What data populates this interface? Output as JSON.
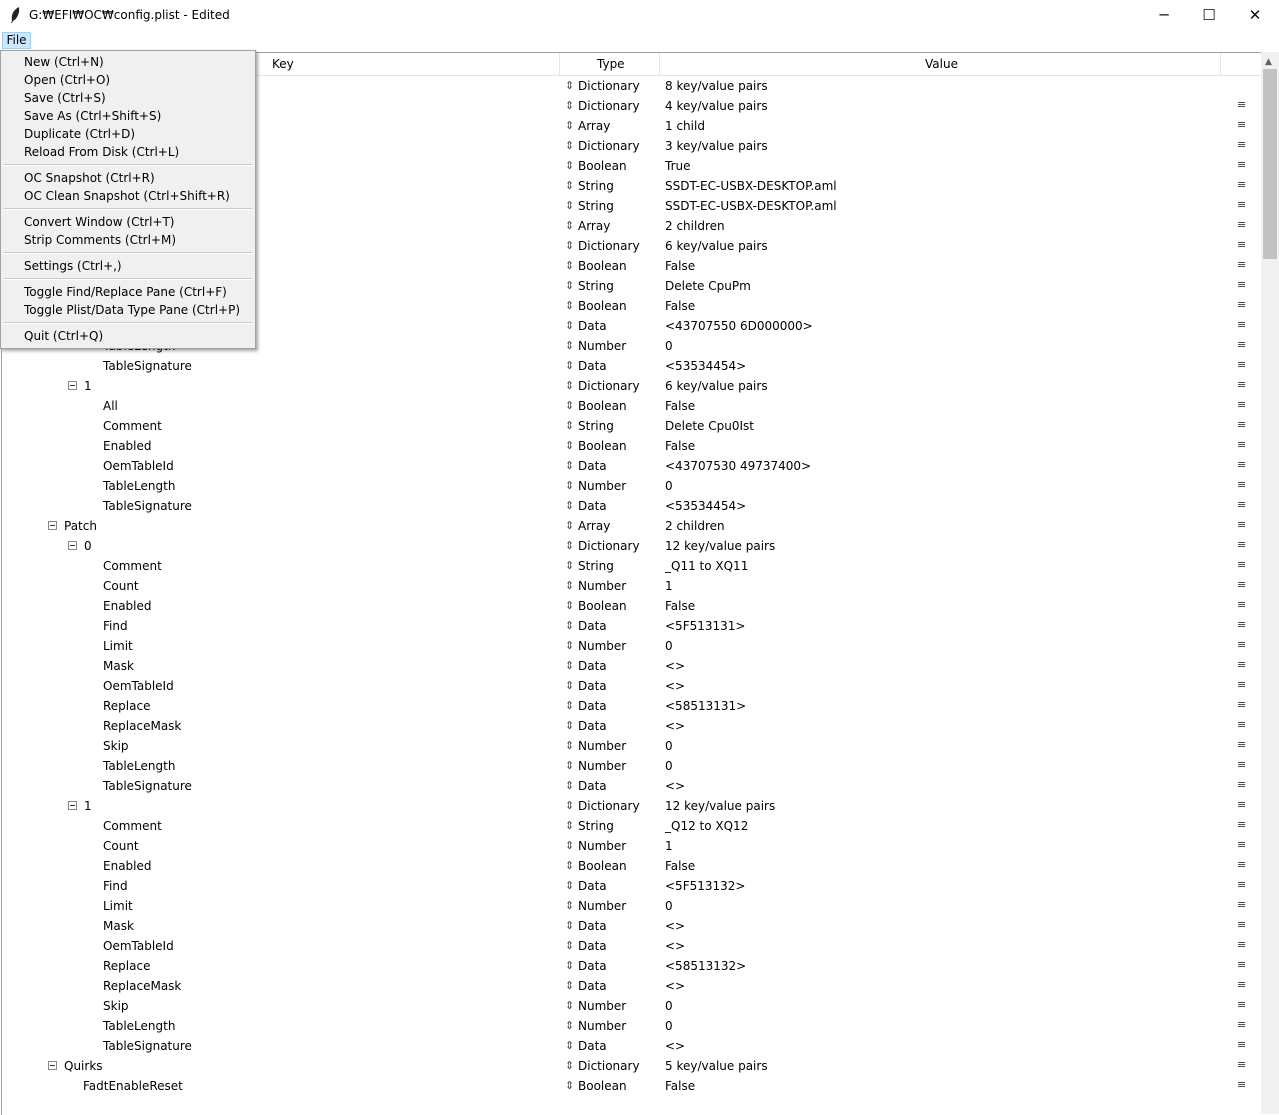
{
  "window": {
    "title": "G:₩EFI₩OC₩config.plist - Edited",
    "minimize": "─",
    "maximize": "☐",
    "close": "✕"
  },
  "menubar": {
    "file": "File"
  },
  "menu": {
    "new": "New (Ctrl+N)",
    "open": "Open (Ctrl+O)",
    "save": "Save (Ctrl+S)",
    "save_as": "Save As (Ctrl+Shift+S)",
    "duplicate": "Duplicate (Ctrl+D)",
    "reload": "Reload From Disk (Ctrl+L)",
    "oc_snapshot": "OC Snapshot (Ctrl+R)",
    "oc_clean_snapshot": "OC Clean Snapshot (Ctrl+Shift+R)",
    "convert_window": "Convert Window (Ctrl+T)",
    "strip_comments": "Strip Comments (Ctrl+M)",
    "settings": "Settings (Ctrl+,)",
    "toggle_find": "Toggle Find/Replace Pane (Ctrl+F)",
    "toggle_plist": "Toggle Plist/Data Type Pane (Ctrl+P)",
    "quit": "Quit (Ctrl+Q)"
  },
  "columns": {
    "key": "Key",
    "type": "Type",
    "value": "Value"
  },
  "rows": [
    {
      "key": "",
      "type": "Dictionary",
      "value": "8 key/value pairs",
      "drag": ""
    },
    {
      "key": "",
      "type": "Dictionary",
      "value": "4 key/value pairs",
      "drag": "≡"
    },
    {
      "key": "",
      "type": "Array",
      "value": "1 child",
      "drag": "≡"
    },
    {
      "key": "",
      "type": "Dictionary",
      "value": "3 key/value pairs",
      "drag": "≡"
    },
    {
      "key": "",
      "type": "Boolean",
      "value": "True",
      "drag": "≡"
    },
    {
      "key": "",
      "type": "String",
      "value": "SSDT-EC-USBX-DESKTOP.aml",
      "drag": "≡"
    },
    {
      "key": "",
      "type": "String",
      "value": "SSDT-EC-USBX-DESKTOP.aml",
      "drag": "≡"
    },
    {
      "key": "",
      "type": "Array",
      "value": "2 children",
      "drag": "≡"
    },
    {
      "key": "",
      "type": "Dictionary",
      "value": "6 key/value pairs",
      "drag": "≡"
    },
    {
      "key": "",
      "type": "Boolean",
      "value": "False",
      "drag": "≡"
    },
    {
      "key": "",
      "type": "String",
      "value": "Delete CpuPm",
      "drag": "≡"
    },
    {
      "key": "",
      "type": "Boolean",
      "value": "False",
      "drag": "≡"
    },
    {
      "key": "",
      "type": "Data",
      "value": "<43707550 6D000000>",
      "drag": "≡"
    },
    {
      "key": "TableLength",
      "type": "Number",
      "value": "0",
      "drag": "≡"
    },
    {
      "key": "TableSignature",
      "type": "Data",
      "value": "<53534454>",
      "drag": "≡"
    },
    {
      "key": "1",
      "type": "Dictionary",
      "value": "6 key/value pairs",
      "drag": "≡"
    },
    {
      "key": "All",
      "type": "Boolean",
      "value": "False",
      "drag": "≡"
    },
    {
      "key": "Comment",
      "type": "String",
      "value": "Delete Cpu0Ist",
      "drag": "≡"
    },
    {
      "key": "Enabled",
      "type": "Boolean",
      "value": "False",
      "drag": "≡"
    },
    {
      "key": "OemTableId",
      "type": "Data",
      "value": "<43707530 49737400>",
      "drag": "≡"
    },
    {
      "key": "TableLength",
      "type": "Number",
      "value": "0",
      "drag": "≡"
    },
    {
      "key": "TableSignature",
      "type": "Data",
      "value": "<53534454>",
      "drag": "≡"
    },
    {
      "key": "Patch",
      "type": "Array",
      "value": "2 children",
      "drag": "≡"
    },
    {
      "key": "0",
      "type": "Dictionary",
      "value": "12 key/value pairs",
      "drag": "≡"
    },
    {
      "key": "Comment",
      "type": "String",
      "value": "_Q11 to XQ11",
      "drag": "≡"
    },
    {
      "key": "Count",
      "type": "Number",
      "value": "1",
      "drag": "≡"
    },
    {
      "key": "Enabled",
      "type": "Boolean",
      "value": "False",
      "drag": "≡"
    },
    {
      "key": "Find",
      "type": "Data",
      "value": "<5F513131>",
      "drag": "≡"
    },
    {
      "key": "Limit",
      "type": "Number",
      "value": "0",
      "drag": "≡"
    },
    {
      "key": "Mask",
      "type": "Data",
      "value": "<>",
      "drag": "≡"
    },
    {
      "key": "OemTableId",
      "type": "Data",
      "value": "<>",
      "drag": "≡"
    },
    {
      "key": "Replace",
      "type": "Data",
      "value": "<58513131>",
      "drag": "≡"
    },
    {
      "key": "ReplaceMask",
      "type": "Data",
      "value": "<>",
      "drag": "≡"
    },
    {
      "key": "Skip",
      "type": "Number",
      "value": "0",
      "drag": "≡"
    },
    {
      "key": "TableLength",
      "type": "Number",
      "value": "0",
      "drag": "≡"
    },
    {
      "key": "TableSignature",
      "type": "Data",
      "value": "<>",
      "drag": "≡"
    },
    {
      "key": "1",
      "type": "Dictionary",
      "value": "12 key/value pairs",
      "drag": "≡"
    },
    {
      "key": "Comment",
      "type": "String",
      "value": "_Q12 to XQ12",
      "drag": "≡"
    },
    {
      "key": "Count",
      "type": "Number",
      "value": "1",
      "drag": "≡"
    },
    {
      "key": "Enabled",
      "type": "Boolean",
      "value": "False",
      "drag": "≡"
    },
    {
      "key": "Find",
      "type": "Data",
      "value": "<5F513132>",
      "drag": "≡"
    },
    {
      "key": "Limit",
      "type": "Number",
      "value": "0",
      "drag": "≡"
    },
    {
      "key": "Mask",
      "type": "Data",
      "value": "<>",
      "drag": "≡"
    },
    {
      "key": "OemTableId",
      "type": "Data",
      "value": "<>",
      "drag": "≡"
    },
    {
      "key": "Replace",
      "type": "Data",
      "value": "<58513132>",
      "drag": "≡"
    },
    {
      "key": "ReplaceMask",
      "type": "Data",
      "value": "<>",
      "drag": "≡"
    },
    {
      "key": "Skip",
      "type": "Number",
      "value": "0",
      "drag": "≡"
    },
    {
      "key": "TableLength",
      "type": "Number",
      "value": "0",
      "drag": "≡"
    },
    {
      "key": "TableSignature",
      "type": "Data",
      "value": "<>",
      "drag": "≡"
    },
    {
      "key": "Quirks",
      "type": "Dictionary",
      "value": "5 key/value pairs",
      "drag": "≡"
    },
    {
      "key": "FadtEnableReset",
      "type": "Boolean",
      "value": "False",
      "drag": "≡"
    }
  ]
}
